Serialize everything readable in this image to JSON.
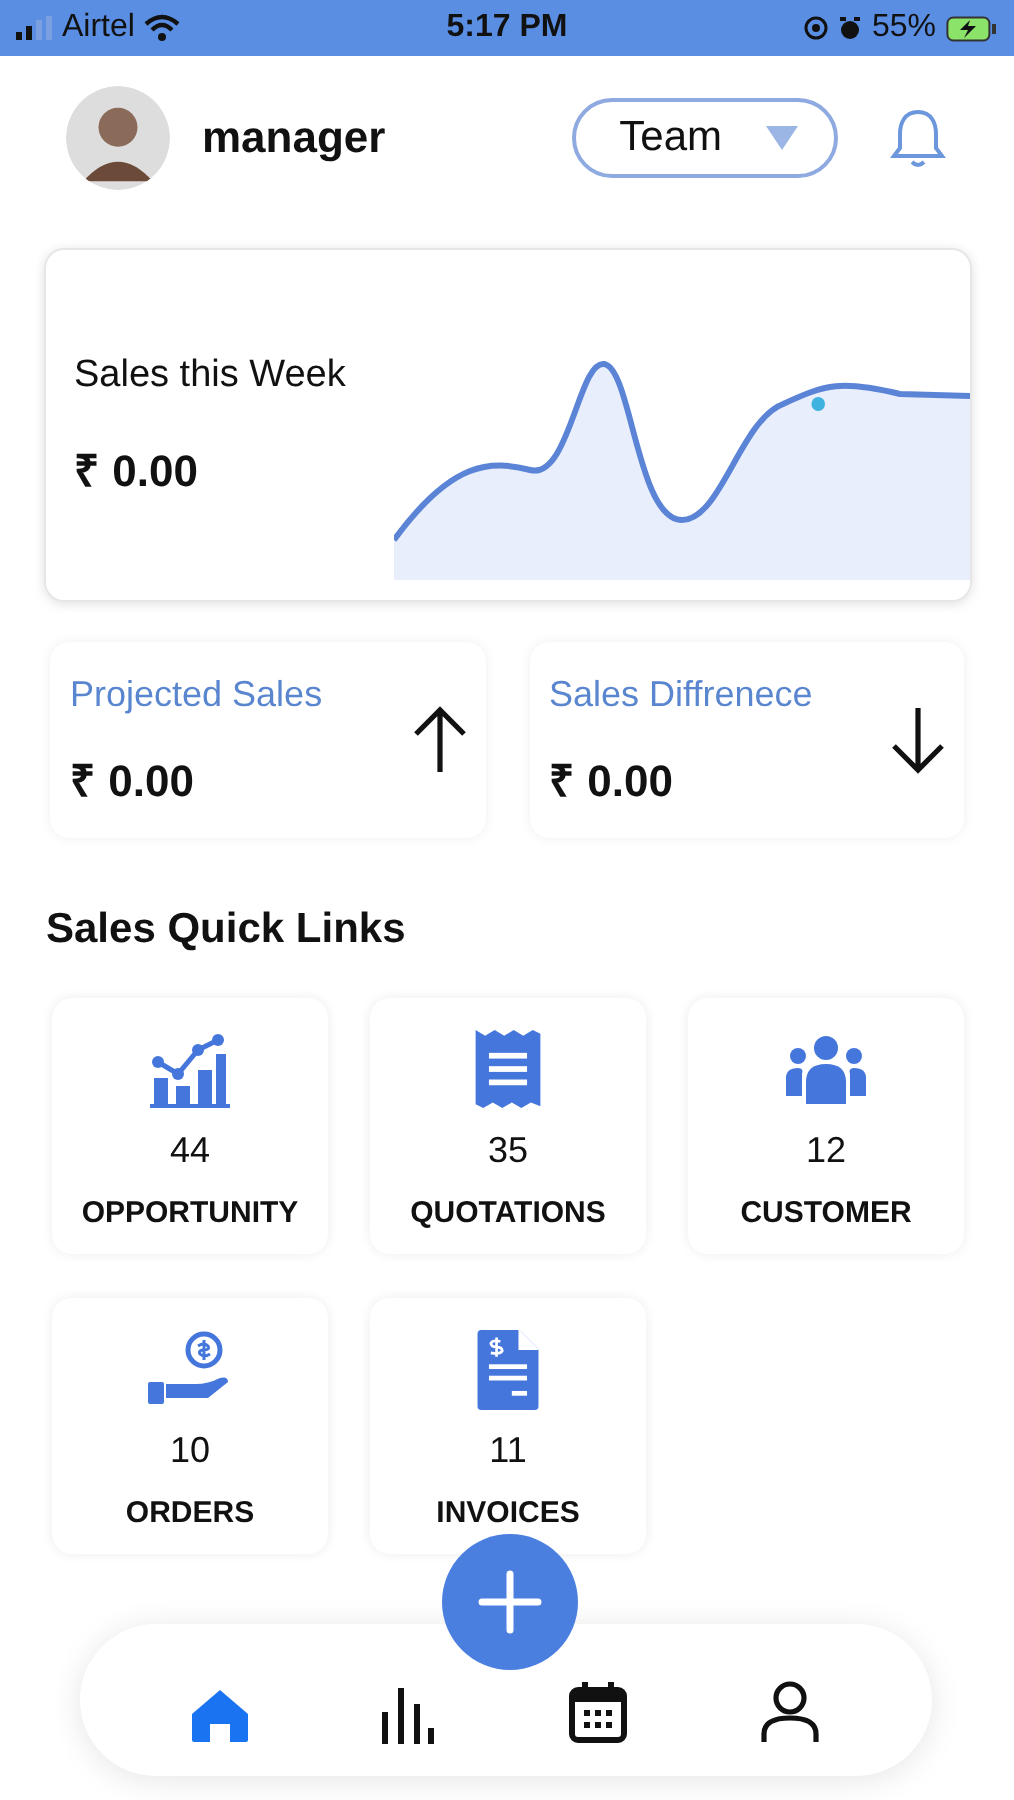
{
  "status_bar": {
    "carrier": "Airtel",
    "time": "5:17 PM",
    "battery": "55%"
  },
  "header": {
    "user": "manager",
    "team_select": {
      "value": "Team"
    }
  },
  "sales_card": {
    "label": "Sales this Week",
    "amount": "₹ 0.00"
  },
  "stats": [
    {
      "label": "Projected Sales",
      "amount": "₹ 0.00",
      "kind": "up"
    },
    {
      "label": "Sales Diffrenece",
      "amount": "₹ 0.00",
      "kind": "down"
    }
  ],
  "quick_links": {
    "title": "Sales Quick Links",
    "items": [
      {
        "kind": "chart",
        "count": "44",
        "label": "OPPORTUNITY"
      },
      {
        "kind": "receipt",
        "count": "35",
        "label": "QUOTATIONS"
      },
      {
        "kind": "people",
        "count": "12",
        "label": "CUSTOMER"
      },
      {
        "kind": "payment",
        "count": "10",
        "label": "ORDERS"
      },
      {
        "kind": "invoice",
        "count": "11",
        "label": "INVOICES"
      }
    ]
  },
  "bottom_nav": [
    {
      "kind": "home",
      "selected": true
    },
    {
      "kind": "stats",
      "selected": false
    },
    {
      "kind": "calendar",
      "selected": false
    },
    {
      "kind": "profile",
      "selected": false
    }
  ]
}
